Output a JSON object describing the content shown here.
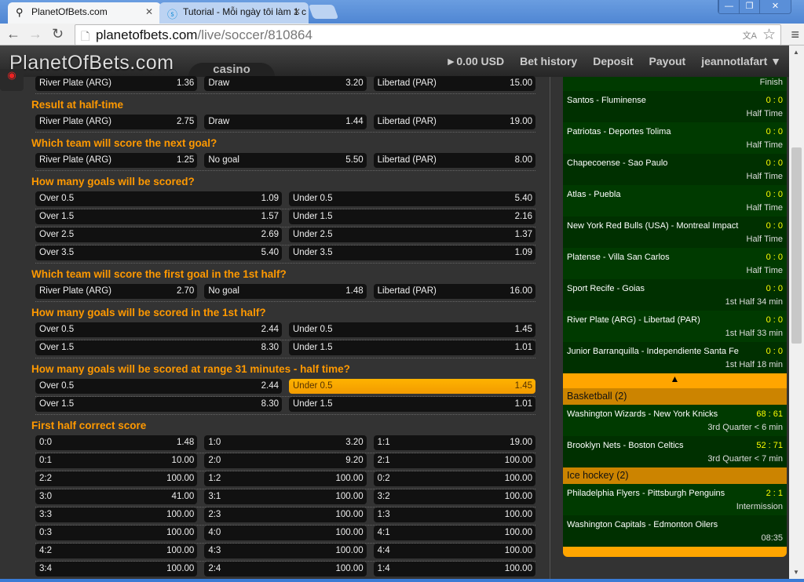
{
  "browser": {
    "tabs": [
      {
        "label": "PlanetOfBets.com",
        "icon": "running-man-icon",
        "active": true
      },
      {
        "label": "Tutorial - Mỗi ngày tôi làm 1 c",
        "icon": "dollar-circle-icon",
        "active": false
      }
    ],
    "url_host": "planetofbets.com",
    "url_path": "/live/soccer/810864"
  },
  "header": {
    "logo": "PlanetOfBets.com",
    "casino": "casino",
    "balance": "►0.00 USD",
    "bet_history": "Bet history",
    "deposit": "Deposit",
    "payout": "Payout",
    "user": "jeannotlafart ▼"
  },
  "markets": [
    {
      "title": "",
      "rows": [
        [
          [
            "River Plate (ARG)",
            "1.36"
          ],
          [
            "Draw",
            "3.20"
          ],
          [
            "Libertad (PAR)",
            "15.00"
          ]
        ]
      ]
    },
    {
      "title": "Result at half-time",
      "rows": [
        [
          [
            "River Plate (ARG)",
            "2.75"
          ],
          [
            "Draw",
            "1.44"
          ],
          [
            "Libertad (PAR)",
            "19.00"
          ]
        ]
      ]
    },
    {
      "title": "Which team will score the next goal?",
      "rows": [
        [
          [
            "River Plate (ARG)",
            "1.25"
          ],
          [
            "No goal",
            "5.50"
          ],
          [
            "Libertad (PAR)",
            "8.00"
          ]
        ]
      ]
    },
    {
      "title": "How many goals will be scored?",
      "rows": [
        [
          [
            "Over 0.5",
            "1.09"
          ],
          [
            "Under 0.5",
            "5.40"
          ]
        ],
        [
          [
            "Over 1.5",
            "1.57"
          ],
          [
            "Under 1.5",
            "2.16"
          ]
        ],
        [
          [
            "Over 2.5",
            "2.69"
          ],
          [
            "Under 2.5",
            "1.37"
          ]
        ],
        [
          [
            "Over 3.5",
            "5.40"
          ],
          [
            "Under 3.5",
            "1.09"
          ]
        ]
      ]
    },
    {
      "title": "Which team will score the first goal in the 1st half?",
      "rows": [
        [
          [
            "River Plate (ARG)",
            "2.70"
          ],
          [
            "No goal",
            "1.48"
          ],
          [
            "Libertad (PAR)",
            "16.00"
          ]
        ]
      ]
    },
    {
      "title": "How many goals will be scored in the 1st half?",
      "rows": [
        [
          [
            "Over 0.5",
            "2.44"
          ],
          [
            "Under 0.5",
            "1.45"
          ]
        ],
        [
          [
            "Over 1.5",
            "8.30"
          ],
          [
            "Under 1.5",
            "1.01"
          ]
        ]
      ]
    },
    {
      "title": "How many goals will be scored at range 31 minutes - half time?",
      "rows": [
        [
          [
            "Over 0.5",
            "2.44"
          ],
          [
            "Under 0.5",
            "1.45",
            "selected"
          ]
        ],
        [
          [
            "Over 1.5",
            "8.30"
          ],
          [
            "Under 1.5",
            "1.01"
          ]
        ]
      ]
    },
    {
      "title": "First half correct score",
      "rows": [
        [
          [
            "0:0",
            "1.48"
          ],
          [
            "1:0",
            "3.20"
          ],
          [
            "1:1",
            "19.00"
          ]
        ],
        [
          [
            "0:1",
            "10.00"
          ],
          [
            "2:0",
            "9.20"
          ],
          [
            "2:1",
            "100.00"
          ]
        ],
        [
          [
            "2:2",
            "100.00"
          ],
          [
            "1:2",
            "100.00"
          ],
          [
            "0:2",
            "100.00"
          ]
        ],
        [
          [
            "3:0",
            "41.00"
          ],
          [
            "3:1",
            "100.00"
          ],
          [
            "3:2",
            "100.00"
          ]
        ],
        [
          [
            "3:3",
            "100.00"
          ],
          [
            "2:3",
            "100.00"
          ],
          [
            "1:3",
            "100.00"
          ]
        ],
        [
          [
            "0:3",
            "100.00"
          ],
          [
            "4:0",
            "100.00"
          ],
          [
            "4:1",
            "100.00"
          ]
        ],
        [
          [
            "4:2",
            "100.00"
          ],
          [
            "4:3",
            "100.00"
          ],
          [
            "4:4",
            "100.00"
          ]
        ],
        [
          [
            "3:4",
            "100.00"
          ],
          [
            "2:4",
            "100.00"
          ],
          [
            "1:4",
            "100.00"
          ]
        ]
      ]
    }
  ],
  "sidebar": {
    "soccer_events": [
      {
        "name": "",
        "score": "",
        "status": "Finish"
      },
      {
        "name": "Santos - Fluminense",
        "score": "0 : 0",
        "status": "Half Time"
      },
      {
        "name": "Patriotas - Deportes Tolima",
        "score": "0 : 0",
        "status": "Half Time"
      },
      {
        "name": "Chapecoense - Sao Paulo",
        "score": "0 : 0",
        "status": "Half Time"
      },
      {
        "name": "Atlas - Puebla",
        "score": "0 : 0",
        "status": "Half Time"
      },
      {
        "name": "New York Red Bulls (USA) - Montreal Impact",
        "score": "0 : 0",
        "status": "Half Time"
      },
      {
        "name": "Platense - Villa San Carlos",
        "score": "0 : 0",
        "status": "Half Time"
      },
      {
        "name": "Sport Recife - Goias",
        "score": "0 : 0",
        "status": "1st Half  34 min"
      },
      {
        "name": "River Plate (ARG) - Libertad (PAR)",
        "score": "0 : 0",
        "status": "1st Half  33 min"
      },
      {
        "name": "Junior Barranquilla - Independiente Santa Fe",
        "score": "0 : 0",
        "status": "1st Half  18 min"
      }
    ],
    "collapse_arrow": "▲",
    "sports": [
      {
        "header": "Basketball (2)",
        "events": [
          {
            "name": "Washington Wizards - New York Knicks",
            "score": "68 : 61",
            "status": "3rd Quarter  < 6 min"
          },
          {
            "name": "Brooklyn Nets - Boston Celtics",
            "score": "52 : 71",
            "status": "3rd Quarter  < 7 min"
          }
        ]
      },
      {
        "header": "Ice hockey (2)",
        "events": [
          {
            "name": "Philadelphia Flyers - Pittsburgh Penguins",
            "score": "2 : 1",
            "status": "Intermission"
          },
          {
            "name": "Washington Capitals - Edmonton Oilers",
            "score": "",
            "status": "08:35"
          }
        ]
      }
    ]
  },
  "colors": {
    "accent": "#ff9900",
    "selected": "#ffa500",
    "event_bg": "#003300",
    "sport_header": "#cc8400",
    "score": "#ffff00"
  }
}
